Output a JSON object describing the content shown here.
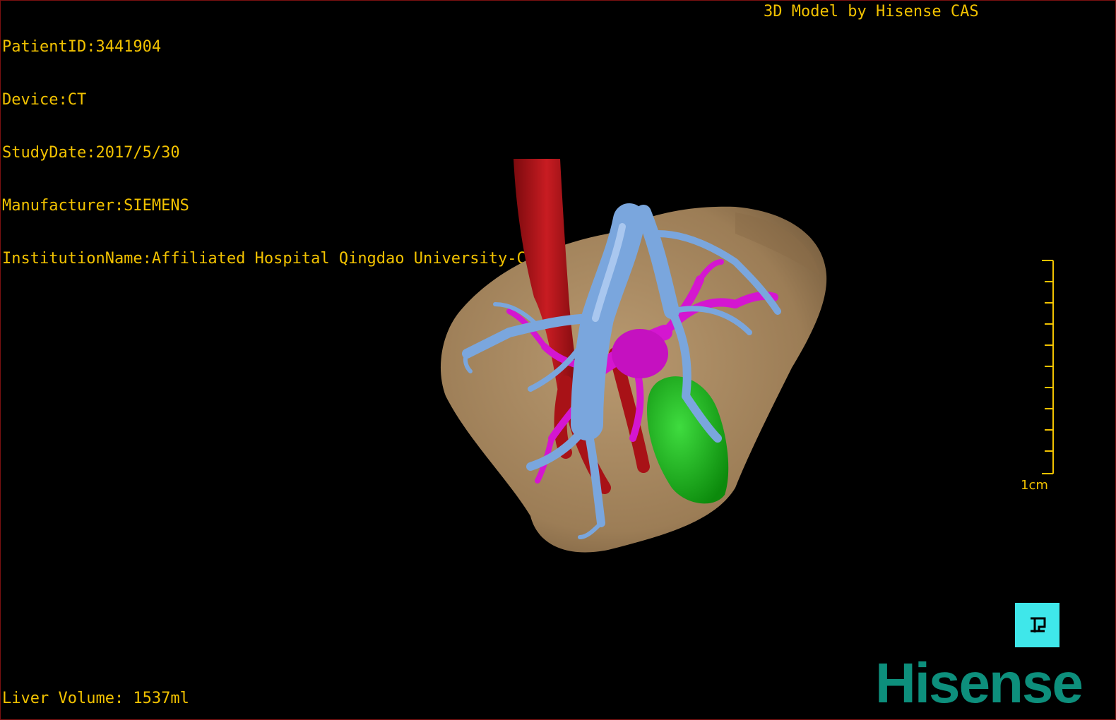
{
  "study_info": {
    "patient_id": "PatientID:3441904",
    "device": "Device:CT",
    "study_date": "StudyDate:2017/5/30",
    "manufacturer": "Manufacturer:SIEMENS",
    "institution": "InstitutionName:Affiliated Hospital Qingdao University-C"
  },
  "credit": "3D Model by Hisense CAS",
  "measurement": {
    "liver_volume": "Liver Volume: 1537ml"
  },
  "scale_bar": {
    "label": "1cm"
  },
  "brand": "Hisense",
  "controls": {
    "reset_view_icon": "reset-view-icon"
  },
  "colors": {
    "overlay_text": "#f2c200",
    "liver": "#a5865f",
    "portal_vein": "#7aa6dd",
    "artery": "#b4141a",
    "hepatic_structure_magenta": "#d416d0",
    "gallbladder": "#1fb51f",
    "reset_button": "#3fe7ea",
    "brand": "#0d8f7c"
  }
}
